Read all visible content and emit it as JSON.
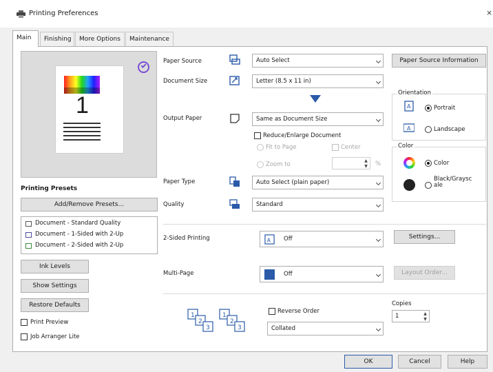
{
  "window": {
    "title": "Printing Preferences",
    "close": "×"
  },
  "tabs": [
    {
      "label": "Main"
    },
    {
      "label": "Finishing"
    },
    {
      "label": "More Options"
    },
    {
      "label": "Maintenance"
    }
  ],
  "preview": {
    "page_number": "1"
  },
  "presets": {
    "heading": "Printing Presets",
    "add_remove_label": "Add/Remove Presets...",
    "items": [
      {
        "label": "Document - Standard Quality"
      },
      {
        "label": "Document - 1-Sided with 2-Up"
      },
      {
        "label": "Document - 2-Sided with 2-Up"
      }
    ]
  },
  "left_buttons": {
    "ink_levels": "Ink Levels",
    "show_settings": "Show Settings",
    "restore_defaults": "Restore Defaults"
  },
  "left_checks": {
    "print_preview": "Print Preview",
    "job_arranger": "Job Arranger Lite"
  },
  "paper_source": {
    "label": "Paper Source",
    "value": "Auto Select",
    "info_button": "Paper Source Information"
  },
  "document_size": {
    "label": "Document Size",
    "value": "Letter (8.5 x 11 in)"
  },
  "output_paper": {
    "label": "Output Paper",
    "value": "Same as Document Size"
  },
  "reduce_enlarge": {
    "label": "Reduce/Enlarge Document",
    "fit_to_page": "Fit to Page",
    "center": "Center",
    "zoom_to": "Zoom to",
    "percent": "%"
  },
  "paper_type": {
    "label": "Paper Type",
    "value": "Auto Select (plain paper)"
  },
  "quality": {
    "label": "Quality",
    "value": "Standard"
  },
  "orientation": {
    "title": "Orientation",
    "portrait": "Portrait",
    "landscape": "Landscape",
    "selected": "Portrait"
  },
  "color": {
    "title": "Color",
    "color_option": "Color",
    "bw_option_line1": "Black/Graysc",
    "bw_option_line2": "ale",
    "selected": "Color"
  },
  "two_sided": {
    "label": "2-Sided Printing",
    "value": "Off",
    "settings_button": "Settings..."
  },
  "multi_page": {
    "label": "Multi-Page",
    "value": "Off",
    "layout_order_button": "Layout Order..."
  },
  "order": {
    "reverse_order": "Reverse Order",
    "collate_value": "Collated"
  },
  "copies": {
    "label": "Copies",
    "value": "1"
  },
  "footer": {
    "ok": "OK",
    "cancel": "Cancel",
    "help": "Help"
  },
  "colors": {
    "accent_blue": "#2a5aa8",
    "checkmark_purple": "#7a4fd3"
  }
}
